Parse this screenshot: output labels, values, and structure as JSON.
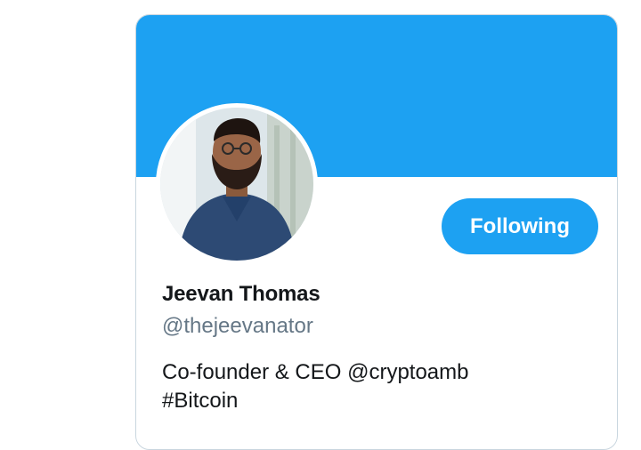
{
  "colors": {
    "accent": "#1da1f2",
    "text_primary": "#14171a",
    "text_secondary": "#657786",
    "card_border": "#c9d6df"
  },
  "profile": {
    "name": "Jeevan Thomas",
    "handle": "@thejeevanator",
    "bio_lines": [
      "Co-founder & CEO @cryptoamb",
      "#Bitcoin"
    ],
    "avatar_icon": "profile-photo"
  },
  "actions": {
    "follow_label": "Following"
  }
}
